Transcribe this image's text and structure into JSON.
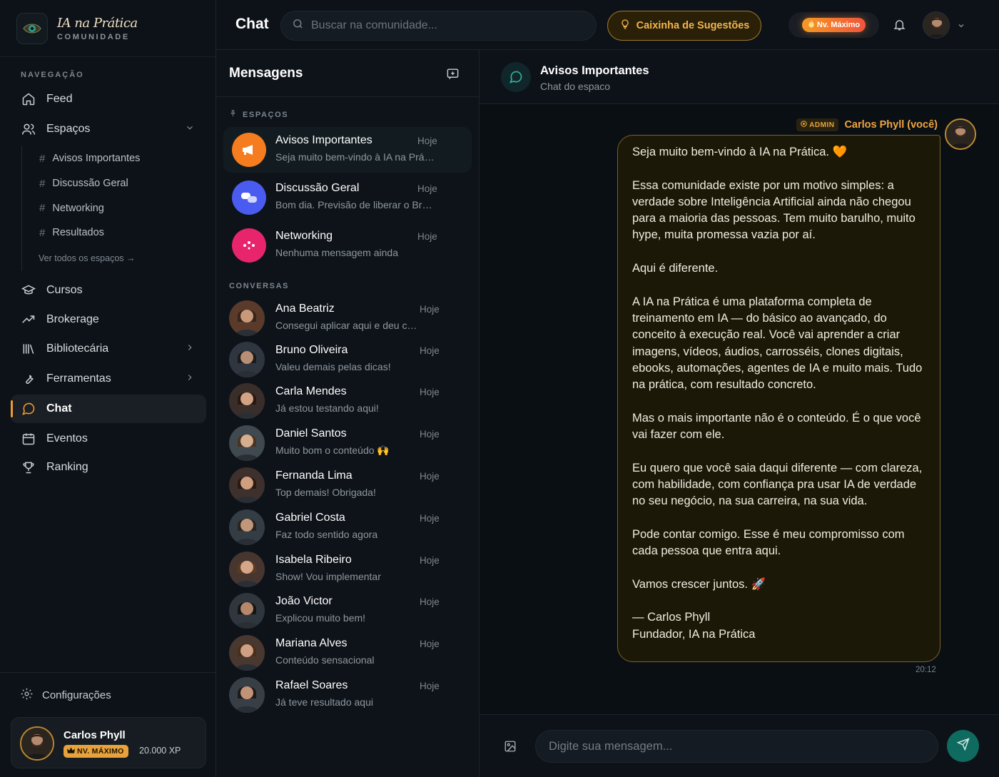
{
  "brand": {
    "name": "IA na Prática",
    "subtitle": "COMUNIDADE"
  },
  "nav": {
    "section_title": "NAVEGAÇÃO",
    "feed": "Feed",
    "spaces": "Espaços",
    "spaces_children": [
      "Avisos Importantes",
      "Discussão Geral",
      "Networking",
      "Resultados"
    ],
    "see_all_spaces": "Ver todos os espaços →",
    "courses": "Cursos",
    "brokerage": "Brokerage",
    "library": "Bibliotecária",
    "tools": "Ferramentas",
    "chat": "Chat",
    "events": "Eventos",
    "ranking": "Ranking",
    "active": "Chat"
  },
  "footer": {
    "settings": "Configurações",
    "user_name": "Carlos Phyll",
    "level": "NV. MÁXIMO",
    "xp": "20.000 XP"
  },
  "topbar": {
    "title": "Chat",
    "search_placeholder": "Buscar na comunidade...",
    "suggestions_button": "Caixinha de Sugestões",
    "level_pill": "Nv. Máximo"
  },
  "messages_panel": {
    "title": "Mensagens",
    "spaces_label": "ESPAÇOS",
    "conversations_label": "CONVERSAS",
    "spaces": [
      {
        "name": "Avisos Importantes",
        "preview": "Seja muito bem-vindo à IA na Prática. 🧡",
        "time": "Hoje",
        "color": "#f57c1f"
      },
      {
        "name": "Discussão Geral",
        "preview": "Bom dia. Previsão de liberar o Brokerage",
        "time": "Hoje",
        "color": "#4a5cf0"
      },
      {
        "name": "Networking",
        "preview": "Nenhuma mensagem ainda",
        "time": "Hoje",
        "color": "#e8256c"
      }
    ],
    "conversations": [
      {
        "name": "Ana Beatriz",
        "preview": "Consegui aplicar aqui e deu certo!",
        "time": "Hoje"
      },
      {
        "name": "Bruno Oliveira",
        "preview": "Valeu demais pelas dicas!",
        "time": "Hoje"
      },
      {
        "name": "Carla Mendes",
        "preview": "Já estou testando aqui!",
        "time": "Hoje"
      },
      {
        "name": "Daniel Santos",
        "preview": "Muito bom o conteúdo 🙌",
        "time": "Hoje"
      },
      {
        "name": "Fernanda Lima",
        "preview": "Top demais! Obrigada!",
        "time": "Hoje"
      },
      {
        "name": "Gabriel Costa",
        "preview": "Faz todo sentido agora",
        "time": "Hoje"
      },
      {
        "name": "Isabela Ribeiro",
        "preview": "Show! Vou implementar",
        "time": "Hoje"
      },
      {
        "name": "João Victor",
        "preview": "Explicou muito bem!",
        "time": "Hoje"
      },
      {
        "name": "Mariana Alves",
        "preview": "Conteúdo sensacional",
        "time": "Hoje"
      },
      {
        "name": "Rafael Soares",
        "preview": "Já teve resultado aqui",
        "time": "Hoje"
      }
    ]
  },
  "chat": {
    "title": "Avisos Importantes",
    "subtitle": "Chat do espaco",
    "admin_tag": "ADMIN",
    "author": "Carlos Phyll (você)",
    "message": "Seja muito bem-vindo à IA na Prática. 🧡\n\nEssa comunidade existe por um motivo simples: a verdade sobre Inteligência Artificial ainda não chegou para a maioria das pessoas. Tem muito barulho, muito hype, muita promessa vazia por aí.\n\nAqui é diferente.\n\nA IA na Prática é uma plataforma completa de treinamento em IA — do básico ao avançado, do conceito à execução real. Você vai aprender a criar imagens, vídeos, áudios, carrosséis, clones digitais, ebooks, automações, agentes de IA e muito mais. Tudo na prática, com resultado concreto.\n\nMas o mais importante não é o conteúdo. É o que você vai fazer com ele.\n\nEu quero que você saia daqui diferente — com clareza, com habilidade, com confiança pra usar IA de verdade no seu negócio, na sua carreira, na sua vida.\n\nPode contar comigo. Esse é meu compromisso com cada pessoa que entra aqui.\n\nVamos crescer juntos. 🚀\n\n— Carlos Phyll\nFundador, IA na Prática",
    "time": "20:12",
    "composer_placeholder": "Digite sua mensagem..."
  },
  "colors": {
    "accent": "#f09a2c",
    "teal": "#0f6b5f",
    "background": "#0c1117"
  }
}
